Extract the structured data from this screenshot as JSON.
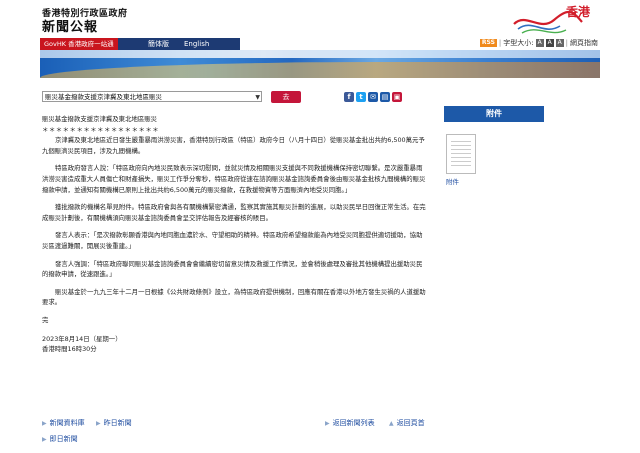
{
  "header": {
    "gov_name": "香港特別行政區政府",
    "site_name": "新聞公報",
    "brand_logo_text": "香港",
    "nav": {
      "govhk": "GovHK 香港政府一站通",
      "simplified": "簡体版",
      "english": "English"
    },
    "util": {
      "rss": "RSS",
      "font_size_label": "字型大小:",
      "sizes": [
        "A",
        "A",
        "A"
      ],
      "accessibility": "網頁指南"
    }
  },
  "toolbar": {
    "select_value": "賑災基金撥款支援京津冀及東北地區賑災",
    "go_label": "去",
    "share": [
      "f",
      "t",
      "✉",
      "▤",
      "▣"
    ]
  },
  "article": {
    "title": "賑災基金撥款支援京津冀及東北地區賑災",
    "stars": "＊＊＊＊＊＊＊＊＊＊＊＊＊＊＊＊＊",
    "paragraphs": [
      "京津冀及東北地區近日發生嚴重暴雨洪澇災害，香港特別行政區（特區）政府今日（八月十四日）從賑災基金批出共約6,500萬元予九個賑濟災民項目，涉及九間機構。",
      "特區政府發言人說：「特區政府向內地災民致表示深切慰問，並就災情及相關賑災支援與不同救援機構保持密切聯繫。是次嚴重暴雨洪澇災害造成重大人員傷亡和財產損失，賑災工作爭分奪秒，特區政府從速在諮詢賑災基金諮詢委員會後由賑災基金批核九間機構的賑災撥款申請，並通知有關機構已原則上批出共約6,500萬元的賑災撥款，在救援物資等方面賑濟內地受災同胞。」",
      "獲批撥款的機構名單見附件。特區政府會與各有關機構緊密溝通，監察其實施其賑災計劃的進展，以助災民早日回復正常生活。在完成賑災計劃後，有關機構須向賑災基金諮詢委員會呈交評估報告及經審核的賬目。",
      "發言人表示：「是次撥款彰顯香港與內地同胞血濃於水、守望相助的精神。特區政府希望撥款能為內地受災同胞提供適切援助，協助災區渡過難關，開展災後重建。」",
      "發言人強調：「特區政府聯同賑災基金諮詢委員會會繼續密切留意災情及救援工作情況，並會稍後處理及審批其他機構提出援助災民的撥款申請，從速跟進。」",
      "賑災基金於一九九三年十二月一日根據《公共財政條例》設立，為特區政府提供機制，回應有關在香港以外地方發生災禍的人道援助要求。"
    ],
    "end_mark": "完",
    "date": "2023年8月14日（星期一）",
    "time": "香港時間16時30分"
  },
  "bottom_nav": {
    "news_archive": "新聞資料庫",
    "yesterday": "昨日新聞",
    "today": "即日新聞",
    "back_list": "返回新聞列表",
    "back_top": "返回頁首"
  },
  "sidebar": {
    "heading": "附件",
    "attachment_label": "附件"
  },
  "colors": {
    "navy": "#1d3a73",
    "red": "#c9151e",
    "go_button": "#c4163a",
    "sidebar_head": "#1d59a8",
    "link": "#1f4da0",
    "rss": "#f08a1d"
  }
}
